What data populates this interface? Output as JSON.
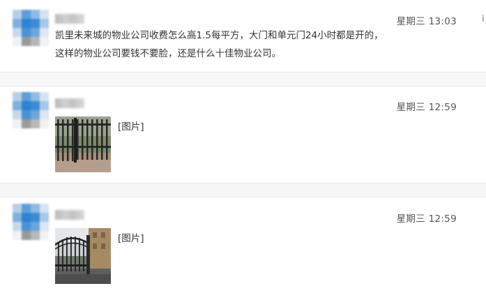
{
  "messages": [
    {
      "time": "星期三 13:03",
      "text_line1": "凯里未来城的物业公司收费怎么高1.5每平方，大门和单元门24小时都是开的，",
      "text_line2": "这样的物业公司要钱不要脸，还是什么十佳物业公司。"
    },
    {
      "time": "星期三 12:59",
      "attachment_label": "[图片]",
      "image_icon": "gate-photo"
    },
    {
      "time": "星期三 12:59",
      "attachment_label": "[图片]",
      "image_icon": "gate-photo"
    }
  ],
  "edge_char": "i",
  "colors": {
    "avatar_blue": "#3f8fd6",
    "avatar_light": "#c9ddef",
    "text": "#333333",
    "time": "#555555",
    "divider": "#e6e6e6"
  }
}
